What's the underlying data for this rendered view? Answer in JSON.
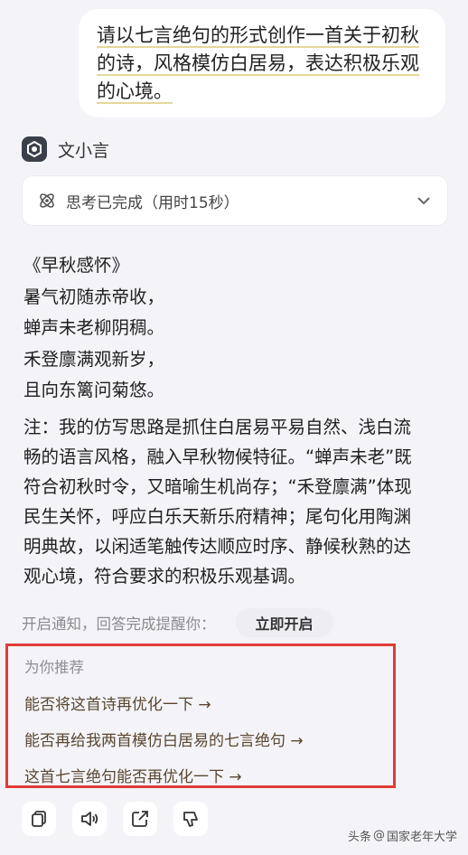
{
  "user_message": {
    "lines": [
      "请以七言绝句的形式创作一首关于初秋",
      "的诗，风格模仿白居易，表达积极乐观",
      "的心境。"
    ]
  },
  "bot": {
    "name": "文小言"
  },
  "thinking": {
    "label": "思考已完成（用时15秒）"
  },
  "poem": {
    "title": "《早秋感怀》",
    "lines": [
      "暑气初随赤帝收，",
      "蝉声未老柳阴稠。",
      "禾登廪满观新岁，",
      "且向东篱问菊悠。"
    ]
  },
  "note": {
    "lines": [
      "注：我的仿写思路是抓住白居易平易自然、浅白流",
      "畅的语言风格，融入早秋物候特征。“蝉声未老”既",
      "符合初秋时令，又暗喻生机尚存；“禾登廪满”体现",
      "民生关怀，呼应白乐天新乐府精神；尾句化用陶渊",
      "明典故，以闲适笔触传达顺应时序、静候秋熟的达",
      "观心境，符合要求的积极乐观基调。"
    ]
  },
  "notify": {
    "text": "开启通知，回答完成提醒你：",
    "button": "立即开启"
  },
  "recommend": {
    "title": "为你推荐",
    "items": [
      "能否将这首诗再优化一下 →",
      "能否再给我两首模仿白居易的七言绝句 →",
      "这首七言绝句能否再优化一下 →"
    ]
  },
  "watermark": {
    "source": "头条",
    "account": "国家老年大学"
  },
  "colors": {
    "accent_text": "#5a4630",
    "highlight_box": "#e23a3a",
    "background": "#f4f4f8"
  }
}
